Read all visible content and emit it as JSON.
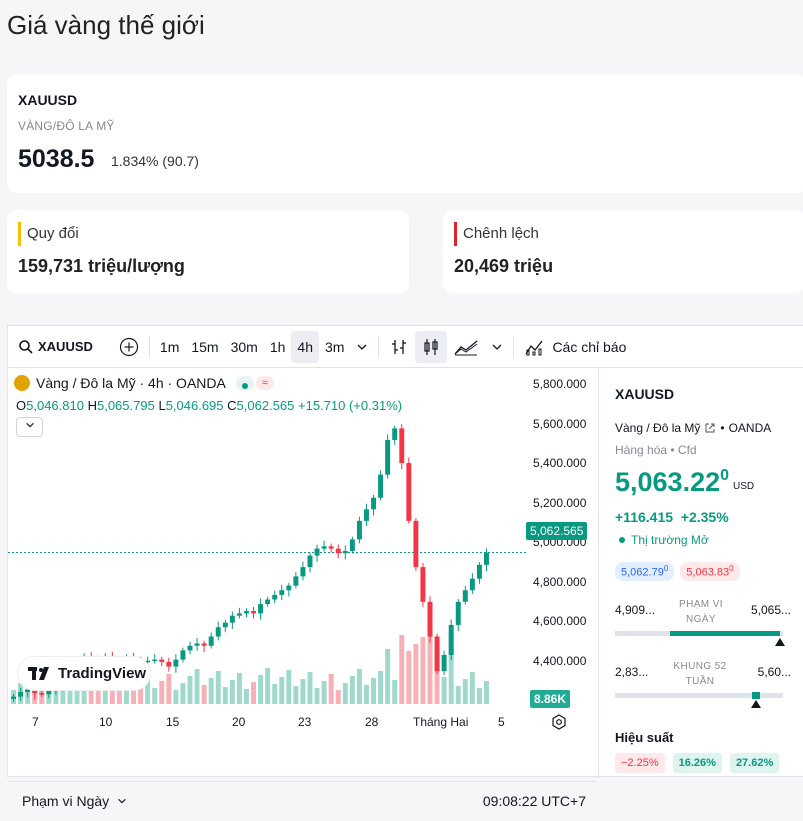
{
  "page_title": "Giá vàng thế giới",
  "quote": {
    "symbol": "XAUUSD",
    "description": "VÀNG/ĐÔ LA MỸ",
    "price": "5038.5",
    "change": "1.834% (90.7)"
  },
  "conversion": {
    "label": "Quy đổi",
    "value": "159,731 triệu/lượng",
    "color": "#f2c200"
  },
  "spread": {
    "label": "Chênh lệch",
    "value": "20,469 triệu",
    "color": "#e0232d"
  },
  "toolbar": {
    "symbol": "XAUUSD",
    "intervals": [
      "1m",
      "15m",
      "30m",
      "1h",
      "4h",
      "3m"
    ],
    "active_interval": "4h",
    "indicators_label": "Các chỉ báo"
  },
  "chart": {
    "legend_title": "Vàng / Đô la Mỹ · 4h · OANDA",
    "ohlc": {
      "o_label": "O",
      "o": "5,046.810",
      "h_label": "H",
      "h": "5,065.795",
      "l_label": "L",
      "l": "5,046.695",
      "c_label": "C",
      "c": "5,062.565",
      "chg": "+15.710 (+0.31%)"
    },
    "price_ticks": [
      "5,800.000",
      "5,600.000",
      "5,400.000",
      "5,200.000",
      "5,000.000",
      "4,800.000",
      "4,600.000",
      "4,400.000"
    ],
    "last_price_tag": "5,062.565",
    "volume_tag": "8.86K",
    "x_ticks": [
      "7",
      "10",
      "15",
      "20",
      "23",
      "28",
      "Tháng Hai",
      "5"
    ],
    "logo_text": "TradingView",
    "range_label": "Phạm vi Ngày",
    "time_label": "09:08:22 UTC+7",
    "up_color": "#089981",
    "down_color": "#f23645"
  },
  "chart_data": {
    "type": "candlestick",
    "title": "Vàng / Đô la Mỹ · 4h · OANDA",
    "ylim": [
      4300,
      5900
    ],
    "x_ticks": [
      "7",
      "10",
      "15",
      "20",
      "23",
      "28",
      "Tháng Hai",
      "5"
    ],
    "close": [
      4440,
      4460,
      4470,
      4455,
      4450,
      4470,
      4490,
      4520,
      4560,
      4590,
      4610,
      4605,
      4600,
      4610,
      4600,
      4595,
      4605,
      4600,
      4590,
      4595,
      4600,
      4590,
      4570,
      4600,
      4640,
      4660,
      4670,
      4660,
      4700,
      4740,
      4760,
      4790,
      4800,
      4810,
      4800,
      4840,
      4860,
      4880,
      4900,
      4920,
      4960,
      5000,
      5050,
      5080,
      5090,
      5080,
      5060,
      5070,
      5120,
      5200,
      5250,
      5300,
      5400,
      5550,
      5600,
      5450,
      5200,
      5000,
      4850,
      4700,
      4550,
      4620,
      4750,
      4850,
      4900,
      4950,
      5010,
      5063
    ]
  },
  "side": {
    "symbol": "XAUUSD",
    "name": "Vàng / Đô la Mỹ",
    "broker": "OANDA",
    "category": "Hàng hóa",
    "type": "Cfd",
    "price": "5,063.22",
    "price_sup": "0",
    "currency": "USD",
    "change": "+116.415",
    "change_pct": "+2.35%",
    "market_status": "Thị trường Mở",
    "bid": "5,062.79",
    "bid_sup": "0",
    "ask": "5,063.83",
    "ask_sup": "0",
    "day_low": "4,909...",
    "day_label": "PHẠM VI NGÀY",
    "day_high": "5,065...",
    "day_fraction": 0.98,
    "w52_low": "2,83...",
    "w52_label": "KHUNG 52 TUẦN",
    "w52_high": "5,60...",
    "w52_fraction": 0.84,
    "perf_label": "Hiệu suất",
    "perf": [
      "−2.25%",
      "16.26%",
      "27.62%"
    ]
  }
}
